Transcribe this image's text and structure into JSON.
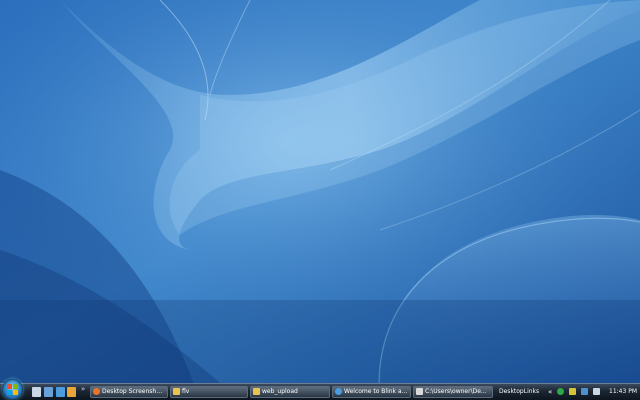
{
  "desktop": {
    "wallpaper": "blue-aurora-wallpaper",
    "colors": {
      "base": "#1e5aa8",
      "light": "#8cc4ee",
      "dark": "#123f84"
    }
  },
  "taskbar": {
    "start_icon": "windows-start-orb-icon",
    "quick_launch": [
      {
        "icon": "show-desktop-icon",
        "color": "#c9d7e6"
      },
      {
        "icon": "switch-windows-icon",
        "color": "#6aa0d8"
      },
      {
        "icon": "internet-explorer-icon",
        "color": "#4a9be0"
      },
      {
        "icon": "media-player-icon",
        "color": "#e8a63a"
      },
      {
        "icon": "folder-icon",
        "color": "#e6c453"
      }
    ],
    "quick_launch_more": "»",
    "tasks": [
      {
        "label": "Desktop Screenshot...",
        "icon": "firefox-icon",
        "color": "#e8742a"
      },
      {
        "label": "flv",
        "icon": "folder-icon",
        "color": "#e6c453"
      },
      {
        "label": "web_upload",
        "icon": "folder-icon",
        "color": "#e6c453"
      },
      {
        "label": "Welcome to Blink a...",
        "icon": "internet-explorer-icon",
        "color": "#4a9be0"
      },
      {
        "label": "C:\\Users\\owner\\De...",
        "icon": "command-prompt-icon",
        "color": "#d9d9d9"
      }
    ],
    "toolbar_label": "DesktopLinks",
    "tray_more": "«",
    "tray_icons": [
      {
        "icon": "security-icon",
        "color": "#2fa84a"
      },
      {
        "icon": "update-icon",
        "color": "#d8c23c"
      },
      {
        "icon": "network-icon",
        "color": "#4f8fd0"
      },
      {
        "icon": "volume-icon",
        "color": "#c9d7e6"
      }
    ],
    "clock": "11:43 PM"
  }
}
